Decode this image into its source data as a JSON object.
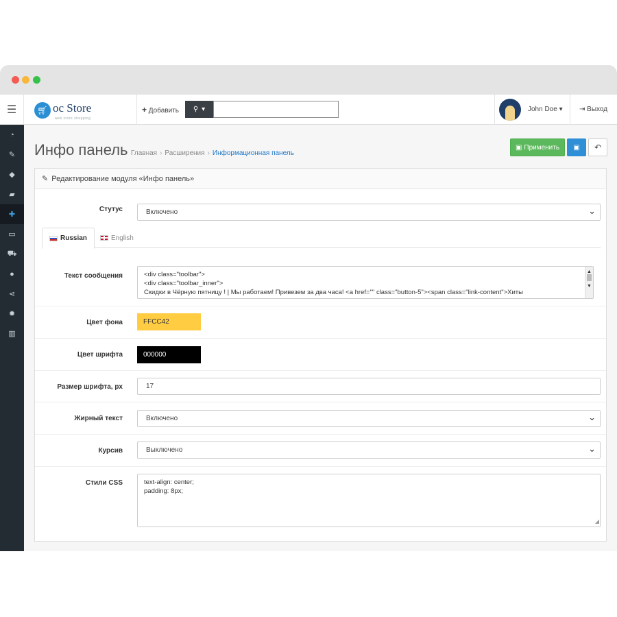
{
  "app": {
    "logo_text": "oc Store",
    "logo_subtitle": "web store shopping"
  },
  "header": {
    "add_label": "Добавить",
    "search_placeholder": "",
    "user_name": "John Doe",
    "logout_label": "Выход"
  },
  "sidebar": {
    "items": [
      {
        "icon": "dashboard-icon",
        "glyph": "◔"
      },
      {
        "icon": "edit-icon",
        "glyph": "✎"
      },
      {
        "icon": "tag-icon",
        "glyph": "◆"
      },
      {
        "icon": "book-icon",
        "glyph": "▰"
      },
      {
        "icon": "puzzle-icon",
        "glyph": "✚",
        "active": true
      },
      {
        "icon": "desktop-icon",
        "glyph": "▭"
      },
      {
        "icon": "cart-icon",
        "glyph": "⛟"
      },
      {
        "icon": "user-icon",
        "glyph": "●"
      },
      {
        "icon": "share-icon",
        "glyph": "⋖"
      },
      {
        "icon": "gear-icon",
        "glyph": "✹"
      },
      {
        "icon": "chart-icon",
        "glyph": "▥"
      }
    ]
  },
  "page": {
    "title": "Инфо панель",
    "breadcrumb": [
      "Главная",
      "Расширения",
      "Информационная панель"
    ],
    "apply_label": "Применить"
  },
  "panel": {
    "heading": "Редактирование модуля «Инфо панель»"
  },
  "form": {
    "status_label": "Стутус",
    "status_value": "Включено",
    "tabs": [
      "Russian",
      "English"
    ],
    "message_label": "Текст сообщения",
    "message_lines": [
      "<div class=\"toolbar\">",
      "<div class=\"toolbar_inner\">",
      "Скидки в Чёрную пятницу ! | Мы работаем!  Привезем за два часа!    <a href=\"\" class=\"button-5\"><span class=\"link-content\">Хиты"
    ],
    "bg_color_label": "Цвет фона",
    "bg_color_value": "FFCC42",
    "bg_color": "#FFCC42",
    "font_color_label": "Цвет шрифта",
    "font_color_value": "000000",
    "font_color": "#000000",
    "font_size_label": "Размер шрифта, px",
    "font_size_value": "17",
    "bold_label": "Жирный текст",
    "bold_value": "Включено",
    "italic_label": "Курсив",
    "italic_value": "Выключено",
    "css_label": "Стили CSS",
    "css_lines": [
      "text-align: center;",
      "padding: 8px;"
    ]
  },
  "colors": {
    "sidebar_bg": "#232b33",
    "accent_blue": "#1e78c8",
    "apply_green": "#5cb85c",
    "save_blue": "#2f8fd6"
  }
}
